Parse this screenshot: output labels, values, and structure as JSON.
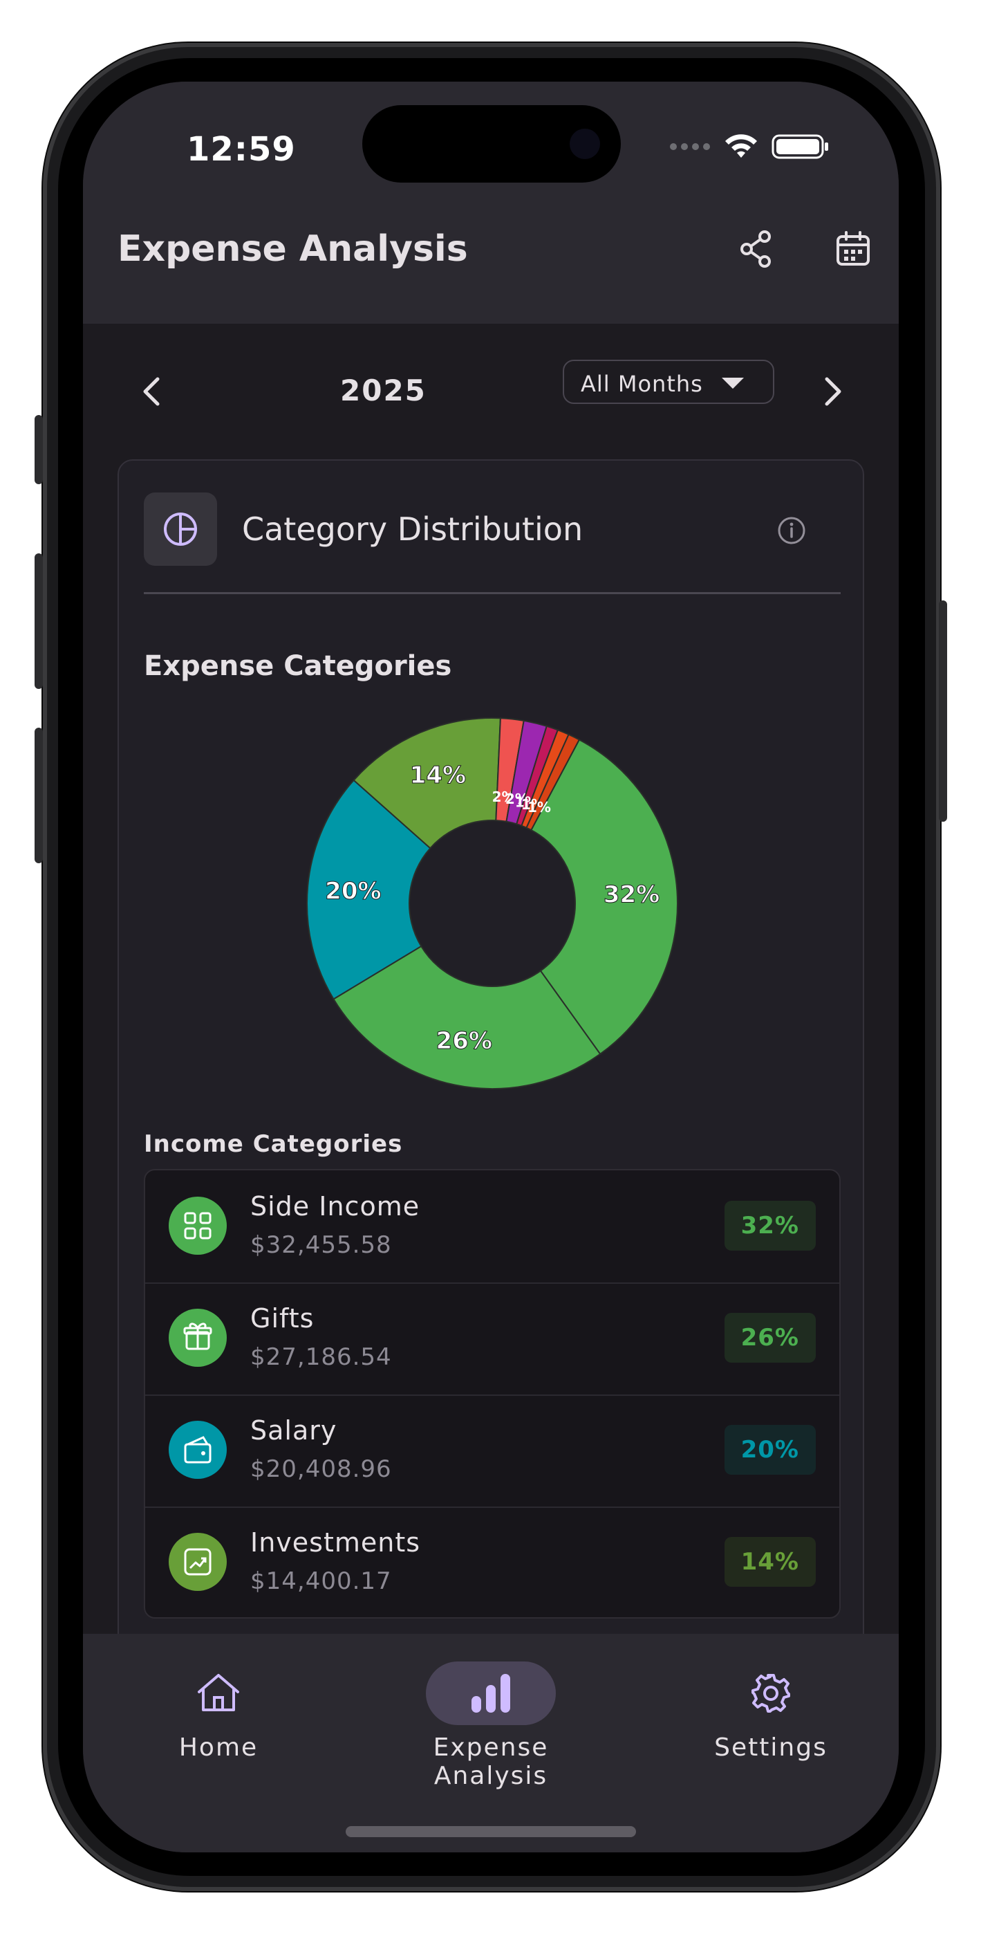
{
  "status_bar": {
    "time": "12:59"
  },
  "header": {
    "title": "Expense Analysis"
  },
  "period": {
    "year": "2025",
    "month_filter": "All Months"
  },
  "card": {
    "title": "Category Distribution",
    "section_title": "Expense Categories"
  },
  "chart_data": {
    "type": "pie",
    "title": "Expense Categories",
    "slices": [
      {
        "label": "Side Income",
        "value": 32,
        "color": "#4caf50"
      },
      {
        "label": "Gifts",
        "value": 26,
        "color": "#4caf50"
      },
      {
        "label": "Salary",
        "value": 20,
        "color": "#0097a7"
      },
      {
        "label": "Investments",
        "value": 14,
        "color": "#689f38"
      },
      {
        "label": "",
        "value": 2,
        "color": "#ef5350"
      },
      {
        "label": "",
        "value": 2,
        "color": "#9c27b0"
      },
      {
        "label": "",
        "value": 1,
        "color": "#c2185b"
      },
      {
        "label": "",
        "value": 1,
        "color": "#e64a19"
      },
      {
        "label": "",
        "value": 1,
        "color": "#d84315"
      }
    ],
    "data_labels": [
      "32%",
      "26%",
      "20%",
      "14%",
      "2%",
      "2%",
      "1%",
      "1%",
      "1%"
    ],
    "hole": true
  },
  "income": {
    "title": "Income Categories",
    "items": [
      {
        "name": "Side Income",
        "amount": "$32,455.58",
        "percent": "32%",
        "icon": "grid-icon",
        "color": "#4caf50",
        "badge_bg": "#1f2c20"
      },
      {
        "name": "Gifts",
        "amount": "$27,186.54",
        "percent": "26%",
        "icon": "gift-icon",
        "color": "#4caf50",
        "badge_bg": "#1f2c20"
      },
      {
        "name": "Salary",
        "amount": "$20,408.96",
        "percent": "20%",
        "icon": "wallet-icon",
        "color": "#0097a7",
        "badge_bg": "#142729"
      },
      {
        "name": "Investments",
        "amount": "$14,400.17",
        "percent": "14%",
        "icon": "trend-icon",
        "color": "#689f38",
        "badge_bg": "#222a1c"
      }
    ]
  },
  "bottom_nav": {
    "items": [
      {
        "label": "Home",
        "icon": "home-icon",
        "active": false
      },
      {
        "label": "Expense Analysis",
        "icon": "bar-chart-icon",
        "active": true
      },
      {
        "label": "Settings",
        "icon": "gear-icon",
        "active": false
      }
    ]
  },
  "colors": {
    "accent": "#cfbcff",
    "active_pill": "#4a4458",
    "background": "#1d1b20",
    "surface": "#2b2930"
  }
}
